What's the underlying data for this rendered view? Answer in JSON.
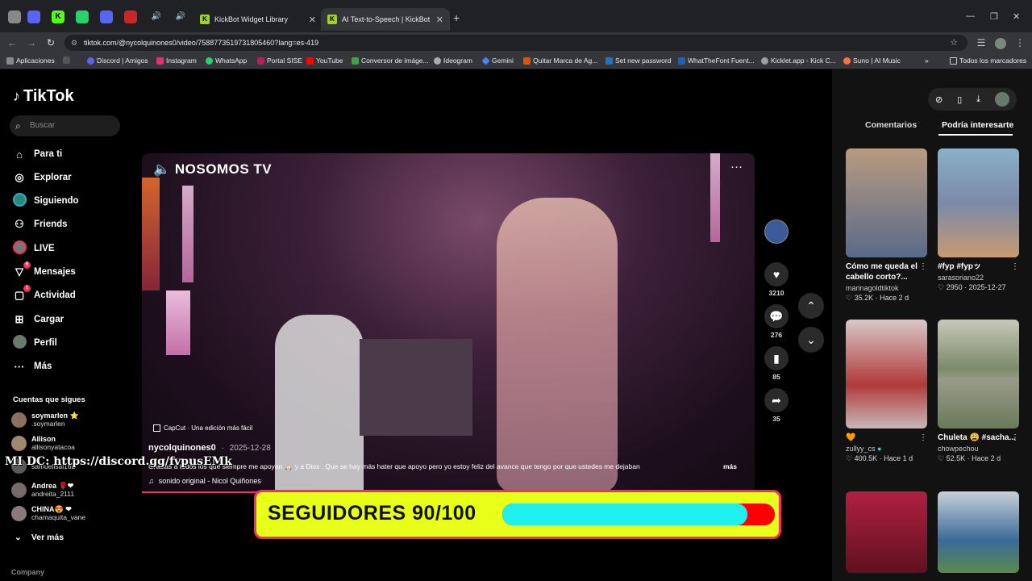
{
  "browser": {
    "tabs": [
      {
        "title": "KickBot Widget Library",
        "active": false
      },
      {
        "title": "AI Text-to-Speech | KickBot",
        "active": true
      }
    ],
    "new_tab": "+",
    "url": "tiktok.com/@nycolquinones0/video/7588773519731805460?lang=es-419",
    "window_controls": {
      "minimize": "—",
      "restore": "❐",
      "close": "✕"
    },
    "bookmarks": [
      {
        "label": "Aplicaciones",
        "color": "#888888"
      },
      {
        "label": "",
        "color": "#555555"
      },
      {
        "label": "Discord | Amigos",
        "color": "#5865f2"
      },
      {
        "label": "Instagram",
        "color": "#e1306c"
      },
      {
        "label": "WhatsApp",
        "color": "#25d366"
      },
      {
        "label": "Portal SISE",
        "color": "#c2185b"
      },
      {
        "label": "YouTube",
        "color": "#ff0000"
      },
      {
        "label": "Conversor de imáge...",
        "color": "#43a047"
      },
      {
        "label": "Ideogram",
        "color": "#aaaaaa"
      },
      {
        "label": "Gemini",
        "color": "#4285f4"
      },
      {
        "label": "Quitar Marca de Ag...",
        "color": "#e65100"
      },
      {
        "label": "Set new password",
        "color": "#1976d2"
      },
      {
        "label": "WhatTheFont Fuent...",
        "color": "#1565c0"
      },
      {
        "label": "Kicklet.app - Kick C...",
        "color": "#9e9e9e"
      },
      {
        "label": "Suno | AI Music",
        "color": "#ff7043"
      }
    ],
    "bookmarks_more": "»",
    "all_bookmarks": "Todos los marcadores"
  },
  "sidebar": {
    "logo": "TikTok",
    "search_placeholder": "Buscar",
    "nav": [
      {
        "label": "Para ti",
        "icon": "⌂",
        "badge": ""
      },
      {
        "label": "Explorar",
        "icon": "◎",
        "badge": ""
      },
      {
        "label": "Siguiendo",
        "icon": "●",
        "badge": ""
      },
      {
        "label": "Friends",
        "icon": "⚇",
        "badge": ""
      },
      {
        "label": "LIVE",
        "icon": "◉",
        "badge": ""
      },
      {
        "label": "Mensajes",
        "icon": "▽",
        "badge": "6"
      },
      {
        "label": "Actividad",
        "icon": "▢",
        "badge": "1"
      },
      {
        "label": "Cargar",
        "icon": "⊞",
        "badge": ""
      },
      {
        "label": "Perfil",
        "icon": "●",
        "badge": ""
      },
      {
        "label": "Más",
        "icon": "···",
        "badge": ""
      }
    ],
    "following_header": "Cuentas que sigues",
    "following": [
      {
        "name": "soymarlen ⭐",
        "handle": ".soymarlen"
      },
      {
        "name": "Allison",
        "handle": "allisonyatacoa"
      },
      {
        "name": "",
        "handle": "samuelisai162"
      },
      {
        "name": "Andrea 🌹❤",
        "handle": "andreita_2111"
      },
      {
        "name": "CHINA😍 ❤",
        "handle": "chamaquita_vane"
      }
    ],
    "see_more": "Ver más",
    "company": "Company"
  },
  "video": {
    "brand": "NOSOMOS TV",
    "capcut": "CapCut · Una edición más fácil",
    "author": "nycolquinones0",
    "date": "2025-12-28",
    "description": "Gracias a todos los que siempre me apoyan 🙏🏻 y a Dios . Que se hay más hater que apoyo pero yo estoy feliz del avance que tengo por que ustedes me dejaban",
    "more": "más",
    "sound": "sonido original - Nicol Quiñones",
    "progress": 0.21
  },
  "actions": {
    "likes": "3210",
    "comments": "276",
    "saves": "85",
    "shares": "35"
  },
  "right_panel": {
    "tabs": [
      "Comentarios",
      "Podría interesarte"
    ],
    "active_tab": 1,
    "cards": [
      {
        "caption": "Cómo me queda el cabello corto?...",
        "user": "marinagoldtiktok",
        "likes": "35.2K",
        "age": "Hace 2 d",
        "color": "#8a6e5e"
      },
      {
        "caption": "#fyp #fypッ",
        "user": "sarasoriano22",
        "likes": "2950",
        "age": "2025-12-27",
        "color": "#6e8fa8"
      },
      {
        "caption": "🧡",
        "user": "zullyy_cs",
        "likes": "400.5K",
        "age": "Hace 1 d",
        "color": "#b03a3a"
      },
      {
        "caption": "Chuleta 😩 #sacha...",
        "user": "chowpechou",
        "likes": "52.5K",
        "age": "Hace 2 d",
        "color": "#7c8a6a"
      },
      {
        "caption": "",
        "user": "",
        "likes": "",
        "age": "",
        "color": "#b02040"
      },
      {
        "caption": "",
        "user": "",
        "likes": "",
        "age": "",
        "color": "#3a6a9a"
      }
    ]
  },
  "overlays": {
    "discord_text": "MI DC: https://discord.gg/fvpusEMk",
    "goal_label": "SEGUIDORES 90/100",
    "goal_progress": 0.9
  }
}
